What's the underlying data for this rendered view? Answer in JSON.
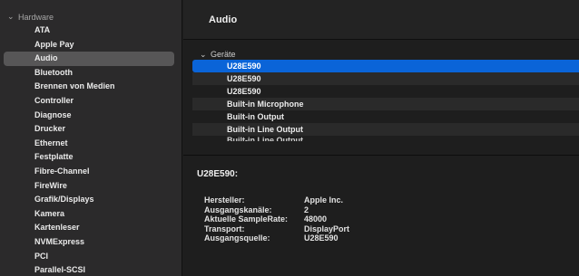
{
  "sidebar": {
    "group_label": "Hardware",
    "items": [
      {
        "label": "ATA"
      },
      {
        "label": "Apple Pay"
      },
      {
        "label": "Audio",
        "selected": true
      },
      {
        "label": "Bluetooth"
      },
      {
        "label": "Brennen von Medien"
      },
      {
        "label": "Controller"
      },
      {
        "label": "Diagnose"
      },
      {
        "label": "Drucker"
      },
      {
        "label": "Ethernet"
      },
      {
        "label": "Festplatte"
      },
      {
        "label": "Fibre-Channel"
      },
      {
        "label": "FireWire"
      },
      {
        "label": "Grafik/Displays"
      },
      {
        "label": "Kamera"
      },
      {
        "label": "Kartenleser"
      },
      {
        "label": "NVMExpress"
      },
      {
        "label": "PCI"
      },
      {
        "label": "Parallel-SCSI"
      }
    ]
  },
  "main": {
    "title": "Audio",
    "tree": {
      "group_label": "Geräte",
      "rows": [
        {
          "label": "U28E590",
          "selected": true
        },
        {
          "label": "U28E590"
        },
        {
          "label": "U28E590"
        },
        {
          "label": "Built-in Microphone"
        },
        {
          "label": "Built-in Output"
        },
        {
          "label": "Built-in Line Output"
        },
        {
          "label": "Built-in Line Output"
        }
      ]
    },
    "details": {
      "title": "U28E590:",
      "properties": [
        {
          "key": "Hersteller:",
          "value": "Apple Inc."
        },
        {
          "key": "Ausgangskanäle:",
          "value": "2"
        },
        {
          "key": "Aktuelle SampleRate:",
          "value": "48000"
        },
        {
          "key": "Transport:",
          "value": "DisplayPort"
        },
        {
          "key": "Ausgangsquelle:",
          "value": "U28E590"
        }
      ]
    }
  },
  "icons": {
    "group_chevron": "chevron-down-icon"
  },
  "colors": {
    "selection_blue": "#0a64d8",
    "sidebar_selected": "#575657",
    "sidebar_bg": "#2b2a2b",
    "main_bg": "#1e1e1e"
  }
}
